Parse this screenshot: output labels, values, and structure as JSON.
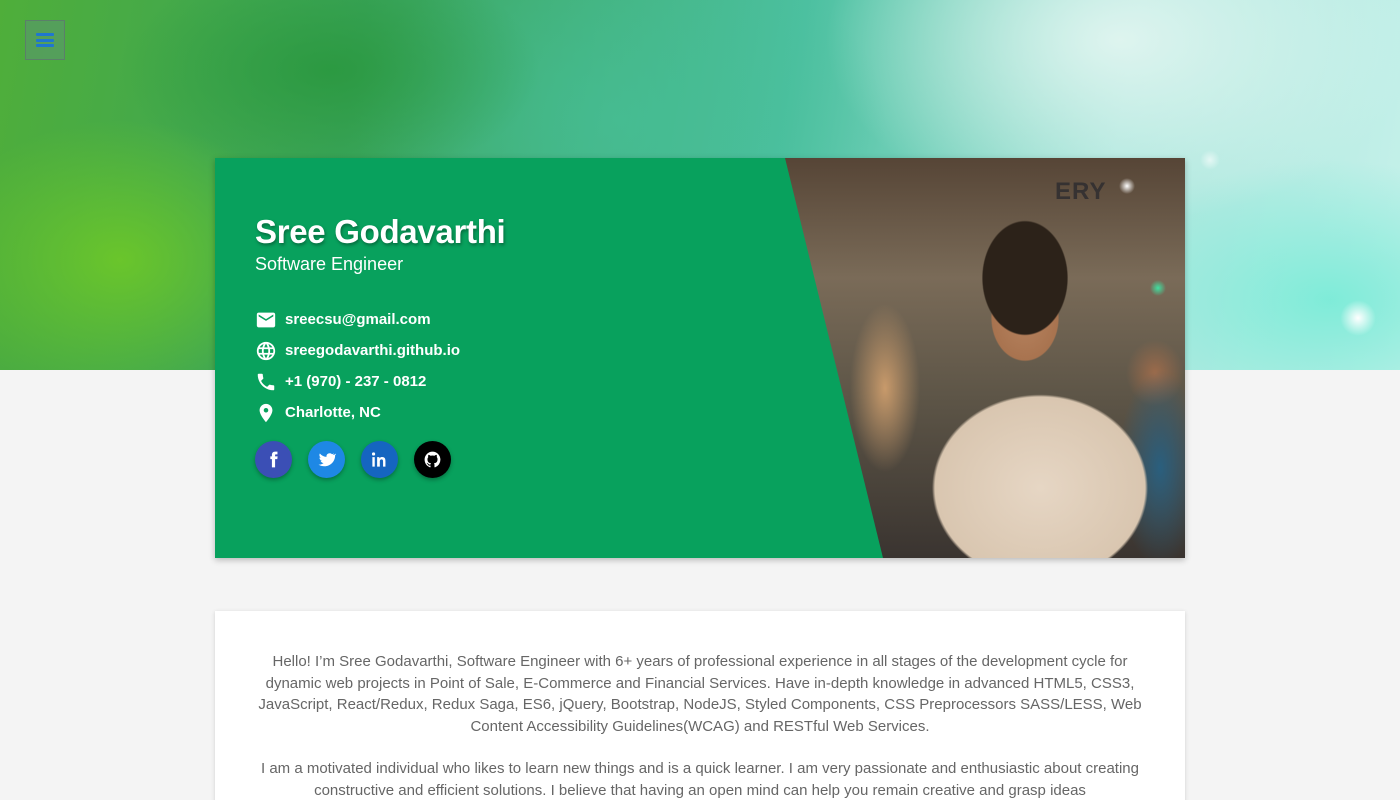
{
  "nav": {
    "menu_icon": "hamburger-icon"
  },
  "profile": {
    "name": "Sree Godavarthi",
    "title": "Software Engineer",
    "contacts": [
      {
        "icon": "email-icon",
        "text": "sreecsu@gmail.com"
      },
      {
        "icon": "globe-icon",
        "text": "sreegodavarthi.github.io"
      },
      {
        "icon": "phone-icon",
        "text": "+1 (970) - 237 - 0812"
      },
      {
        "icon": "location-pin-icon",
        "text": "Charlotte, NC"
      }
    ],
    "socials": [
      {
        "icon": "facebook-icon",
        "color": "#3b4fb5"
      },
      {
        "icon": "twitter-icon",
        "color": "#1e88e5"
      },
      {
        "icon": "linkedin-icon",
        "color": "#1565c0"
      },
      {
        "icon": "github-icon",
        "color": "#000000"
      }
    ],
    "photo_sign": "ERY"
  },
  "about": {
    "paragraphs": [
      "Hello! I’m Sree Godavarthi, Software Engineer with 6+ years of professional experience in all stages of the development cycle for dynamic web projects in Point of Sale, E-Commerce and Financial Services. Have in-depth knowledge in advanced HTML5, CSS3, JavaScript, React/Redux, Redux Saga, ES6, jQuery, Bootstrap, NodeJS, Styled Components, CSS Preprocessors SASS/LESS, Web Content Accessibility Guidelines(WCAG) and RESTful Web Services.",
      "I am a motivated individual who likes to learn new things and is a quick learner. I am very passionate and enthusiastic about creating constructive and efficient solutions. I believe that having an open mind can help you remain creative and grasp ideas"
    ]
  },
  "colors": {
    "card_green": "#08a15d",
    "menu_icon": "#1f77d0"
  }
}
